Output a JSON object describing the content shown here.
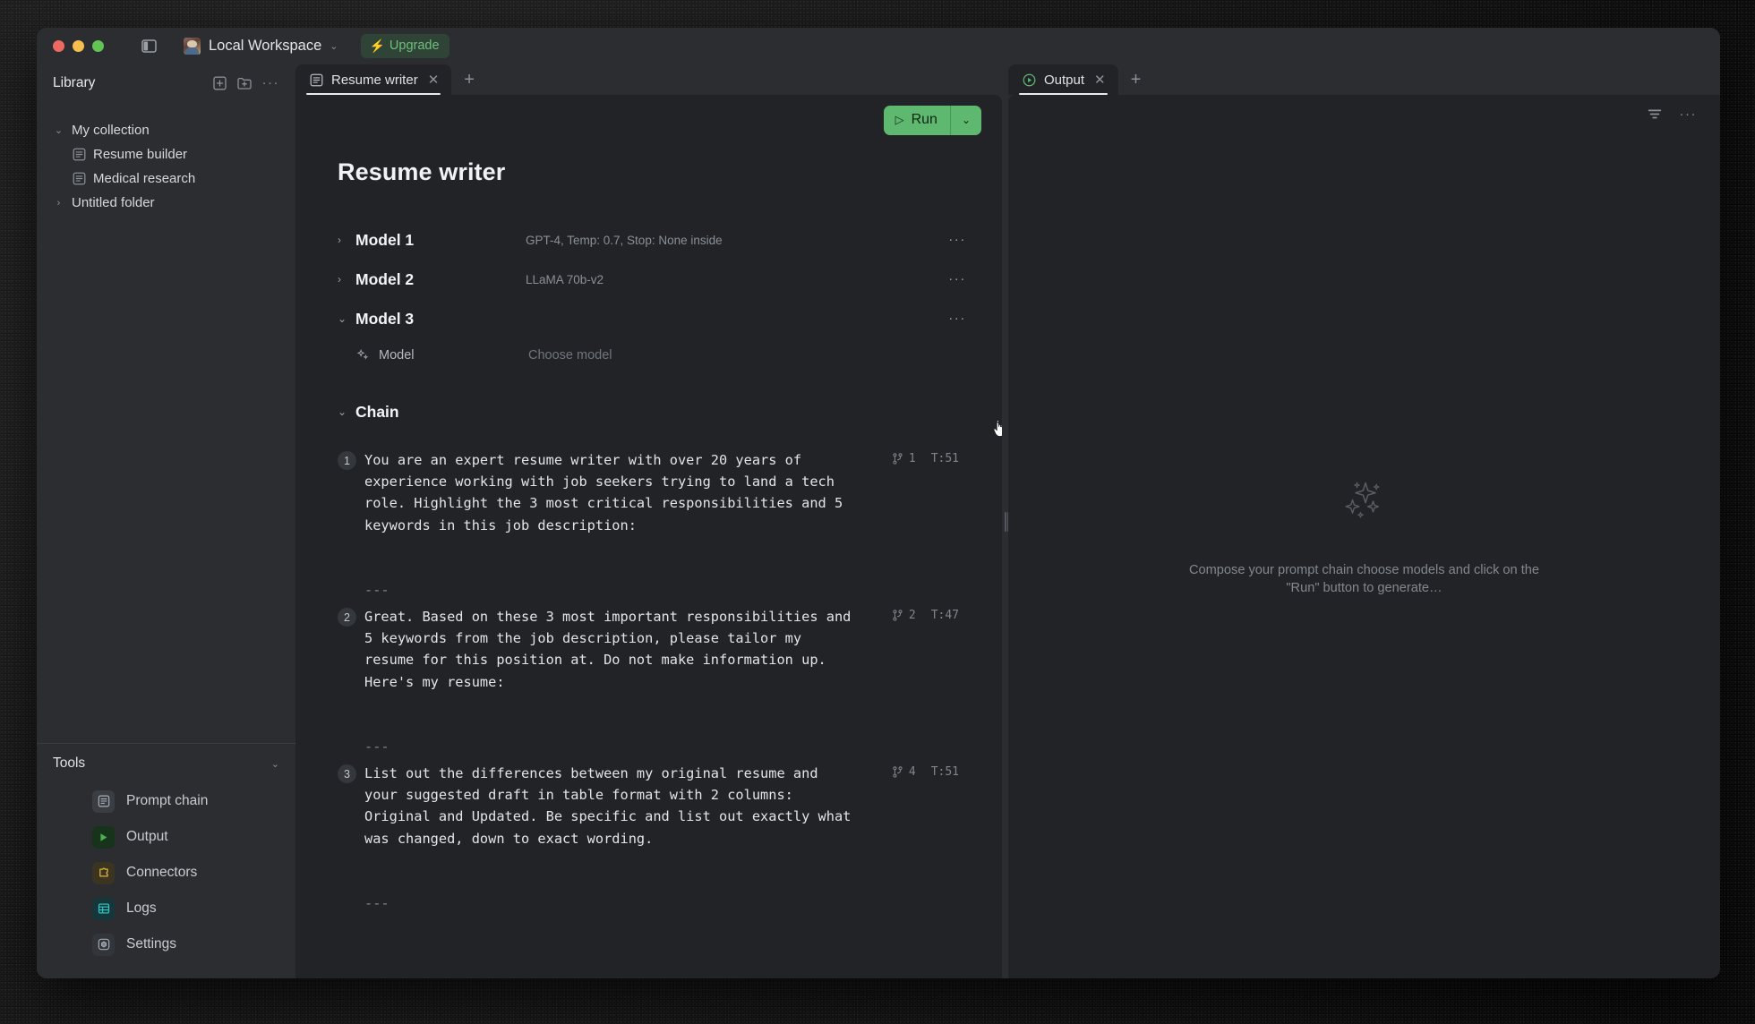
{
  "titlebar": {
    "workspace_label": "Local Workspace",
    "workspace_caret": "⌄",
    "upgrade_label": "Upgrade",
    "bolt_glyph": "⚡",
    "panel_toggle_icon": "sidebar-toggle-icon",
    "accent_green": "#5fb870",
    "upgrade_bg": "#2f4436"
  },
  "sidebar": {
    "title": "Library",
    "header_icons": [
      "new-file-icon",
      "new-folder-icon",
      "more-icon"
    ],
    "tree": [
      {
        "label": "My collection",
        "type": "folder",
        "expanded": true,
        "chevron": "⌄",
        "depth": 0
      },
      {
        "label": "Resume builder",
        "type": "doc",
        "depth": 1
      },
      {
        "label": "Medical research",
        "type": "doc",
        "depth": 1
      },
      {
        "label": "Untitled folder",
        "type": "folder",
        "expanded": false,
        "chevron": "›",
        "depth": 0
      }
    ],
    "tools": {
      "title": "Tools",
      "collapse_chevron": "⌄",
      "items": [
        {
          "label": "Prompt chain",
          "icon": "document-icon",
          "color": "#aab0b6",
          "bg": "#3a3d42"
        },
        {
          "label": "Output",
          "icon": "play-icon",
          "color": "#4caf50",
          "bg": "#18331c"
        },
        {
          "label": "Connectors",
          "icon": "puzzle-icon",
          "color": "#e0b13c",
          "bg": "#3a3420"
        },
        {
          "label": "Logs",
          "icon": "table-icon",
          "color": "#2ec8c8",
          "bg": "#16373a"
        },
        {
          "label": "Settings",
          "icon": "gear-icon",
          "color": "#a7adb3",
          "bg": "#32353a"
        }
      ]
    }
  },
  "editor": {
    "tab": {
      "label": "Resume writer",
      "close_glyph": "✕",
      "icon": "document-icon"
    },
    "new_tab_glyph": "+",
    "run_button": {
      "label": "Run",
      "play_glyph": "▷",
      "caret_glyph": "⌄"
    },
    "doc_title": "Resume writer",
    "models": [
      {
        "name": "Model 1",
        "meta": "GPT-4, Temp: 0.7, Stop: None inside",
        "expanded": false,
        "chevron": "›",
        "menu": "···"
      },
      {
        "name": "Model 2",
        "meta": "LLaMA 70b-v2",
        "expanded": false,
        "chevron": "›",
        "menu": "···"
      },
      {
        "name": "Model 3",
        "meta": "",
        "expanded": true,
        "chevron": "⌄",
        "menu": "···"
      }
    ],
    "model3_field": {
      "label": "Model",
      "value": "Choose model",
      "icon": "sparkle-icon"
    },
    "chain": {
      "title": "Chain",
      "chevron": "⌄",
      "separator": "---",
      "steps": [
        {
          "number": "1",
          "text": "You are an expert resume writer with over 20 years of experience working with job seekers trying to land a tech role. Highlight the 3 most critical responsibilities and 5 keywords in this job description:",
          "branches": "1",
          "tokens": "T:51"
        },
        {
          "number": "2",
          "text": "Great. Based on these 3 most important responsibilities and 5 keywords from the job description, please tailor my resume for this position at. Do not make information up. Here's my resume:",
          "branches": "2",
          "tokens": "T:47"
        },
        {
          "number": "3",
          "text": "List out the differences between my original resume and your suggested draft in table format with 2 columns: Original and Updated. Be specific and list out exactly what was changed, down to exact wording.",
          "branches": "4",
          "tokens": "T:51"
        }
      ]
    }
  },
  "output": {
    "tab": {
      "label": "Output",
      "close_glyph": "✕",
      "icon": "play-circle-icon"
    },
    "new_tab_glyph": "+",
    "toolbar_icons": [
      "filter-icon",
      "more-icon"
    ],
    "empty_state": {
      "icon": "sparkles-icon",
      "message": "Compose your prompt chain choose models and click on the \"Run\" button to generate…"
    }
  }
}
